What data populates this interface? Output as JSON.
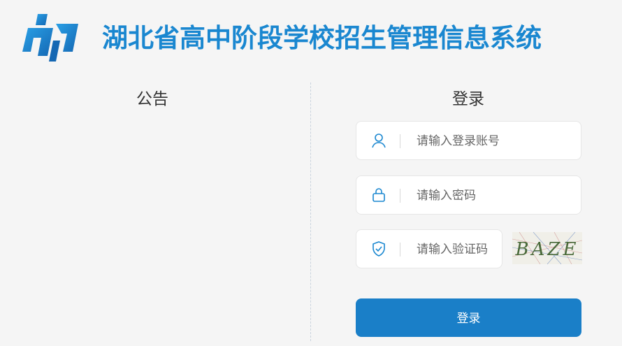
{
  "header": {
    "title": "湖北省高中阶段学校招生管理信息系统",
    "logo_icon": "hubei-admission-logo-icon",
    "brand_color": "#1a87d0"
  },
  "notice": {
    "title": "公告"
  },
  "login": {
    "title": "登录",
    "username": {
      "placeholder": "请输入登录账号",
      "value": "",
      "icon": "user-icon"
    },
    "password": {
      "placeholder": "请输入密码",
      "value": "",
      "icon": "lock-icon"
    },
    "captcha_input": {
      "placeholder": "请输入验证码",
      "value": "",
      "icon": "shield-check-icon"
    },
    "captcha_text": "BAZE",
    "submit_label": "登录",
    "button_color": "#1a7fc8"
  }
}
